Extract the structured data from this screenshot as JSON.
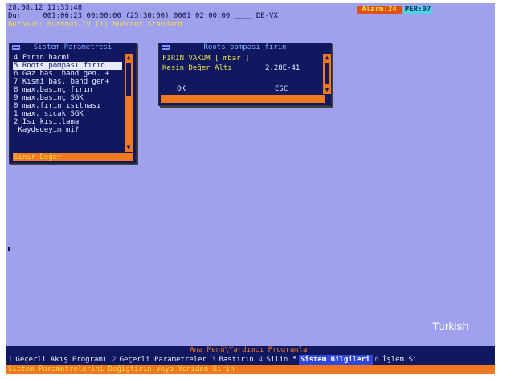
{
  "status": {
    "line1": "28.08.12 11:33:48",
    "line2": "Dur     001:06:23 00:00:00 (25:30:00) 0001 02:00:00 ____ DE-VX",
    "line3": "burnout: burnout-TV (1) burnout standard",
    "alarm": "Alarm:24",
    "per": "PER:07"
  },
  "system_window": {
    "title": "Sistem Parametresi",
    "items": [
      "4 Fırın hacmi",
      "5 Roots pompası fırın",
      "6 Gaz bas. band gen. +",
      "7 Kısmi bas. band gen+",
      "8 max.basınç fırın",
      "9 max.basınç SGK",
      "0 max.fırın ısıtması",
      "1 max. sıcak SGK",
      "2 Isı kısıtlama",
      " Kaydedeyim mi?",
      "Sınır Değer"
    ],
    "selected_index": 1
  },
  "roots_window": {
    "title": "Roots pompası fırın",
    "unit_label": "FIRIN VAKUM [ mbar ]",
    "field_label": "Kesin Değer Altı",
    "field_value": "2.28E-41",
    "ok_label": "OK",
    "esc_label": "ESC"
  },
  "overlay_text": "Turkish",
  "menu": {
    "title": "Ana Menü\\Yardımcı Programlar",
    "fkeys": [
      {
        "num": "1",
        "label": "Geçerli Akış Programı"
      },
      {
        "num": "2",
        "label": "Geçerli Parametreler"
      },
      {
        "num": "3",
        "label": "Bastırın"
      },
      {
        "num": "4",
        "label": "Silin"
      },
      {
        "num": "5",
        "label": "Sistem Bilgileri",
        "active": true
      },
      {
        "num": "6",
        "label": "İşlem Si"
      }
    ],
    "hint": "Sistem Parametrelerini Değiştirin veya Yeniden Girin"
  }
}
